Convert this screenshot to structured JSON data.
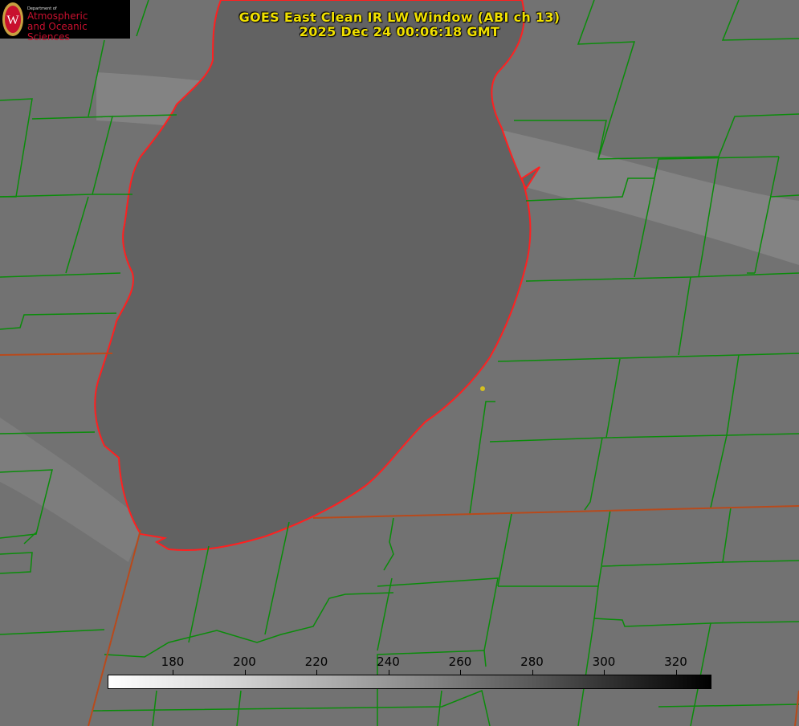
{
  "title_line1": "GOES East Clean IR LW Window (ABI ch 13)",
  "title_line2": "2025 Dec 24 00:06:18 GMT",
  "logo": {
    "dept": "Department of",
    "line1": "Atmospheric",
    "line2": "and Oceanic Sciences",
    "seal_letter": "W"
  },
  "colorbar": {
    "tick_labels": [
      "180",
      "200",
      "220",
      "240",
      "260",
      "280",
      "300",
      "320"
    ],
    "gradient": "white-to-black"
  },
  "colors": {
    "county_lines": "#0a8c0a",
    "state_border": "#b84a1c",
    "coastline": "#ff2020",
    "title": "#f0e000",
    "marker": "#d4c020"
  }
}
